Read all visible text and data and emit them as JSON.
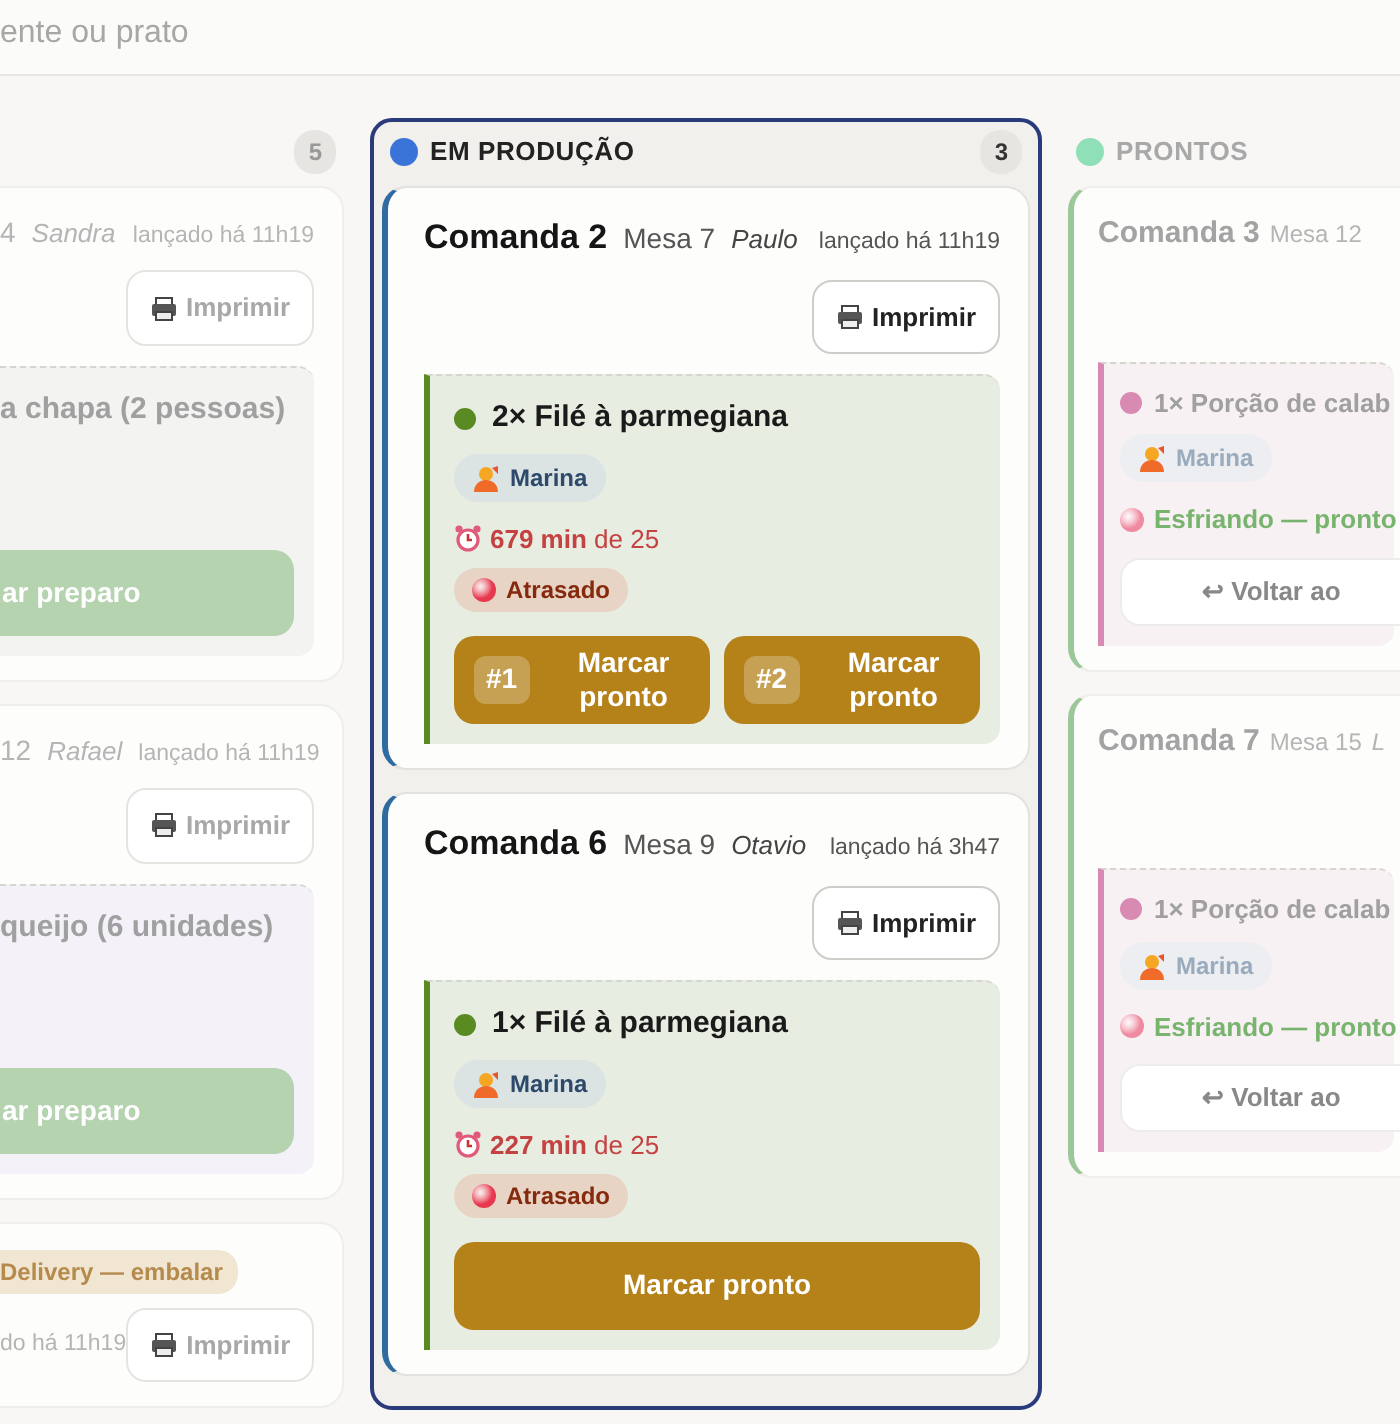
{
  "search": {
    "placeholder": "ente ou prato"
  },
  "columns": [
    {
      "selected": false,
      "count": "5",
      "cards": [
        {
          "table": "4",
          "waiter": "Sandra",
          "launched": "lançado há 11h19",
          "print_button": "Imprimir",
          "items": [
            {
              "name": "a chapa (2 pessoas)",
              "buttons": [
                {
                  "kind": "start",
                  "label": "ar preparo"
                }
              ]
            }
          ]
        },
        {
          "table": "12",
          "waiter": "Rafael",
          "launched": "lançado há 11h19",
          "print_button": "Imprimir",
          "items": [
            {
              "name": "queijo (6 unidades)",
              "buttons": [
                {
                  "kind": "start",
                  "label": "ar preparo"
                }
              ]
            }
          ]
        },
        {
          "tag": "Delivery — embalar",
          "launched": "do há 11h19",
          "print_button": "Imprimir"
        }
      ]
    },
    {
      "selected": true,
      "color": "#3b74d9",
      "title": "EM PRODUÇÃO",
      "count": "3",
      "cards": [
        {
          "title": "Comanda 2",
          "table": "Mesa 7",
          "waiter": "Paulo",
          "launched": "lançado há 11h19",
          "print_button": "Imprimir",
          "items": [
            {
              "color": "#5a8a22",
              "name": "2× Filé à parmegiana",
              "cook": "Marina",
              "timer": "**679 min** de 25",
              "status": {
                "kind": "late",
                "label": "Atrasado"
              },
              "buttons": [
                {
                  "kind": "ready",
                  "tag": "#1",
                  "label": "Marcar pronto"
                },
                {
                  "kind": "ready",
                  "tag": "#2",
                  "label": "Marcar pronto"
                }
              ]
            }
          ]
        },
        {
          "title": "Comanda 6",
          "table": "Mesa 9",
          "waiter": "Otavio",
          "launched": "lançado há 3h47",
          "print_button": "Imprimir",
          "items": [
            {
              "color": "#5a8a22",
              "name": "1× Filé à parmegiana",
              "cook": "Marina",
              "timer": "**227 min** de 25",
              "status": {
                "kind": "late",
                "label": "Atrasado"
              },
              "buttons": [
                {
                  "kind": "ready",
                  "label": "Marcar pronto"
                }
              ]
            }
          ]
        }
      ]
    },
    {
      "selected": false,
      "color": "#8fe0b8",
      "title": "PRONTOS",
      "cards": [
        {
          "title": "Comanda 3",
          "table": "Mesa 12",
          "items": [
            {
              "color": "#d98ab3",
              "name": "1× Porção de calab",
              "cook": "Marina",
              "status": {
                "kind": "cooling",
                "label": "Esfriando — pronto"
              },
              "buttons": [
                {
                  "kind": "back",
                  "label": "↩ Voltar ao"
                }
              ]
            }
          ]
        },
        {
          "title": "Comanda 7",
          "table": "Mesa 15",
          "waiter": "L",
          "items": [
            {
              "color": "#d98ab3",
              "name": "1× Porção de calab",
              "cook": "Marina",
              "status": {
                "kind": "cooling",
                "label": "Esfriando — pronto"
              },
              "buttons": [
                {
                  "kind": "back",
                  "label": "↩ Voltar ao"
                }
              ]
            }
          ]
        }
      ]
    }
  ]
}
